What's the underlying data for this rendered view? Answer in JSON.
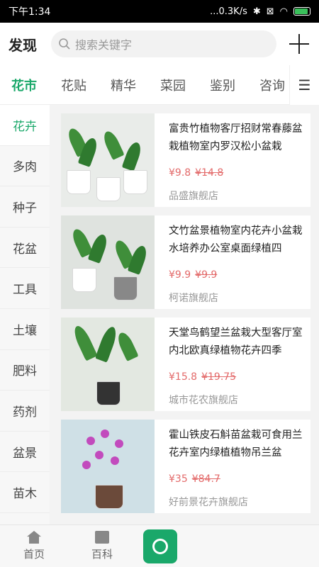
{
  "status": {
    "time": "下午1:34",
    "network": "...0.3K/s",
    "battery_level": 0.8
  },
  "header": {
    "title": "发现",
    "search_placeholder": "搜索关键字"
  },
  "tabs": [
    "花市",
    "花贴",
    "精华",
    "菜园",
    "鉴别",
    "咨询"
  ],
  "sidebar": [
    "花卉",
    "多肉",
    "种子",
    "花盆",
    "工具",
    "土壤",
    "肥料",
    "药剂",
    "盆景",
    "苗木"
  ],
  "products": [
    {
      "name": "富贵竹植物客厅招财常春藤盆栽植物室内罗汉松小盆栽",
      "price": "¥9.8",
      "orig": "¥14.8",
      "shop": "品盛旗舰店"
    },
    {
      "name": "文竹盆景植物室内花卉小盆栽水培养办公室桌面绿植四",
      "price": "¥9.9",
      "orig": "¥9.9",
      "shop": "柯诺旗舰店"
    },
    {
      "name": "天堂鸟鹤望兰盆栽大型客厅室内北欧真绿植物花卉四季",
      "price": "¥15.8",
      "orig": "¥19.75",
      "shop": "城市花农旗舰店"
    },
    {
      "name": "霍山铁皮石斛苗盆栽可食用兰花卉室内绿植植物吊兰盆",
      "price": "¥35",
      "orig": "¥84.7",
      "shop": "好前景花卉旗舰店"
    }
  ],
  "bottom_nav": {
    "home": "首页",
    "encyclopedia": "百科"
  }
}
